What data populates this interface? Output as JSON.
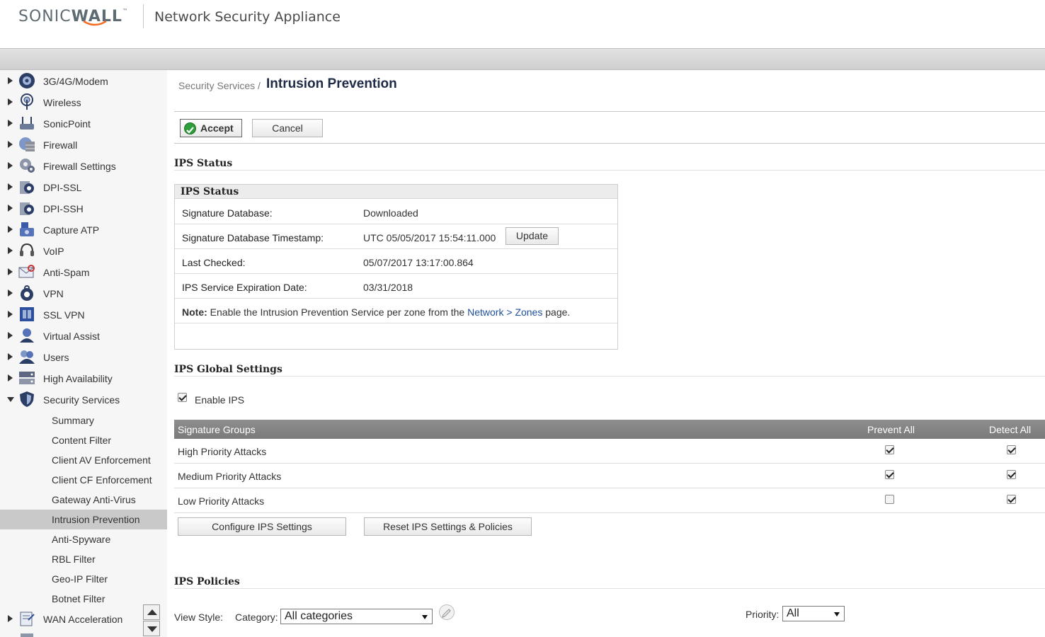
{
  "header": {
    "logo_sonic": "SONIC",
    "logo_wall": "WALL",
    "logo_tm": "™",
    "app_title": "Network Security Appliance"
  },
  "sidebar": {
    "items": [
      {
        "label": "3G/4G/Modem",
        "icon": "modem-icon"
      },
      {
        "label": "Wireless",
        "icon": "wireless-icon"
      },
      {
        "label": "SonicPoint",
        "icon": "sonicpoint-icon"
      },
      {
        "label": "Firewall",
        "icon": "firewall-icon"
      },
      {
        "label": "Firewall Settings",
        "icon": "firewall-settings-icon"
      },
      {
        "label": "DPI-SSL",
        "icon": "dpi-ssl-icon"
      },
      {
        "label": "DPI-SSH",
        "icon": "dpi-ssh-icon"
      },
      {
        "label": "Capture ATP",
        "icon": "capture-atp-icon"
      },
      {
        "label": "VoIP",
        "icon": "voip-headset-icon"
      },
      {
        "label": "Anti-Spam",
        "icon": "anti-spam-icon"
      },
      {
        "label": "VPN",
        "icon": "vpn-lock-icon"
      },
      {
        "label": "SSL VPN",
        "icon": "ssl-vpn-icon"
      },
      {
        "label": "Virtual Assist",
        "icon": "virtual-assist-icon"
      },
      {
        "label": "Users",
        "icon": "users-icon"
      },
      {
        "label": "High Availability",
        "icon": "high-availability-icon"
      },
      {
        "label": "Security Services",
        "icon": "security-shield-icon"
      }
    ],
    "sub_items": [
      {
        "label": "Summary"
      },
      {
        "label": "Content Filter"
      },
      {
        "label": "Client AV Enforcement"
      },
      {
        "label": "Client CF Enforcement"
      },
      {
        "label": "Gateway Anti-Virus"
      },
      {
        "label": "Intrusion Prevention",
        "active": true
      },
      {
        "label": "Anti-Spyware"
      },
      {
        "label": "RBL Filter"
      },
      {
        "label": "Geo-IP Filter"
      },
      {
        "label": "Botnet Filter"
      }
    ],
    "after_items": [
      {
        "label": "WAN Acceleration",
        "icon": "wan-acceleration-icon"
      }
    ]
  },
  "page": {
    "breadcrumb": "Security Services /",
    "title": "Intrusion Prevention",
    "accept_label": "Accept",
    "cancel_label": "Cancel"
  },
  "ips_status": {
    "section_title": "IPS Status",
    "box_title": "IPS Status",
    "signature_database_label": "Signature Database:",
    "signature_database_value": "Downloaded",
    "timestamp_label": "Signature Database Timestamp:",
    "timestamp_value": "UTC 05/05/2017 15:54:11.000",
    "update_label": "Update",
    "last_checked_label": "Last Checked:",
    "last_checked_value": "05/07/2017 13:17:00.864",
    "expiration_label": "IPS Service Expiration Date:",
    "expiration_value": "03/31/2018",
    "note_bold": "Note:",
    "note_text": " Enable the Intrusion Prevention Service per zone from the ",
    "note_link_network": "Network",
    "note_sep": " > ",
    "note_link_zones": "Zones",
    "note_end": " page."
  },
  "ips_global": {
    "section_title": "IPS Global Settings",
    "enable_label": "Enable IPS",
    "enable_checked": true,
    "grid": {
      "col_groups": "Signature Groups",
      "col_prevent": "Prevent All",
      "col_detect": "Detect All",
      "rows": [
        {
          "label": "High Priority Attacks",
          "prevent": true,
          "detect": true
        },
        {
          "label": "Medium Priority Attacks",
          "prevent": true,
          "detect": true
        },
        {
          "label": "Low Priority Attacks",
          "prevent": false,
          "detect": true
        }
      ]
    },
    "configure_label": "Configure IPS Settings",
    "reset_label": "Reset IPS Settings & Policies"
  },
  "ips_policies": {
    "section_title": "IPS Policies",
    "view_style_label": "View Style:",
    "category_label": "Category:",
    "category_value": "All categories",
    "priority_label": "Priority:",
    "priority_value": "All"
  },
  "colors": {
    "title": "#1e2a47",
    "link": "#1f4e9b",
    "grid_header": "#838383",
    "active_nav": "#c9c9c9",
    "accept_green": "#2e9e3a",
    "logo_orange": "#f26b21"
  }
}
